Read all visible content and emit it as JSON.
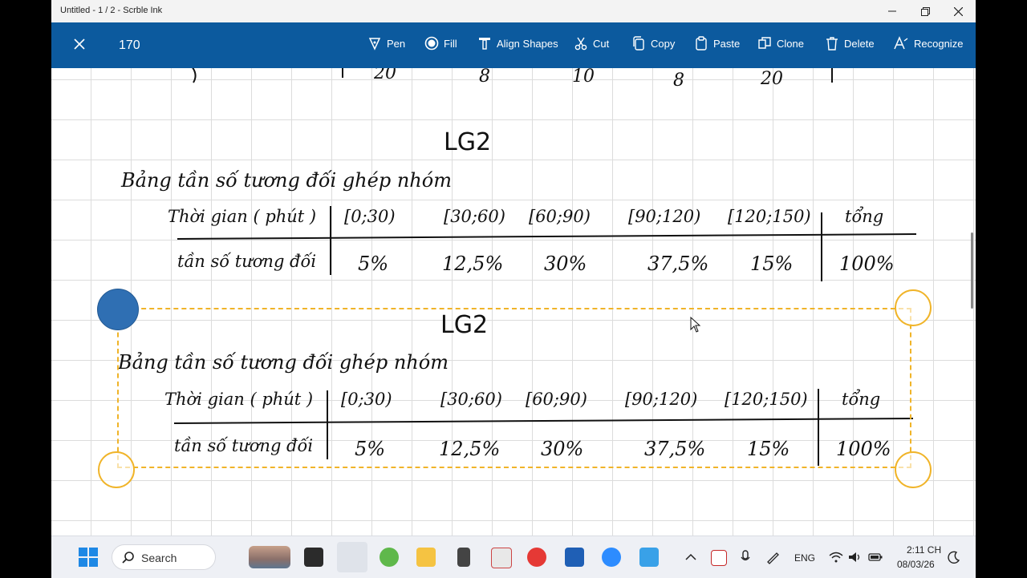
{
  "window": {
    "title": "Untitled - 1 / 2 - Scrble Ink"
  },
  "toolbar": {
    "selection_count": "170",
    "items": [
      {
        "label": "Pen",
        "icon": "pen-icon"
      },
      {
        "label": "Fill",
        "icon": "fill-icon"
      },
      {
        "label": "Align Shapes",
        "icon": "align-shapes-icon"
      },
      {
        "label": "Cut",
        "icon": "scissors-icon"
      },
      {
        "label": "Copy",
        "icon": "copy-icon"
      },
      {
        "label": "Paste",
        "icon": "paste-icon"
      },
      {
        "label": "Clone",
        "icon": "clone-icon"
      },
      {
        "label": "Delete",
        "icon": "trash-icon"
      },
      {
        "label": "Recognize",
        "icon": "recognize-icon"
      }
    ]
  },
  "note": {
    "top_row_partial": [
      "20",
      "8",
      "10",
      "8",
      "20"
    ],
    "heading": "LG2",
    "table_title": "Bảng tần số tương đối ghép nhóm",
    "row_header_1": "Thời gian ( phút )",
    "row_header_2": "tần số tương đối",
    "columns": [
      "[0;30)",
      "[30;60)",
      "[60;90)",
      "[90;120)",
      "[120;150)",
      "tổng"
    ],
    "values": [
      "5%",
      "12,5%",
      "30%",
      "37,5%",
      "15%",
      "100%"
    ]
  },
  "taskbar": {
    "search_label": "Search",
    "language": "ENG",
    "time": "2:11 CH",
    "date": "08/03/26"
  }
}
